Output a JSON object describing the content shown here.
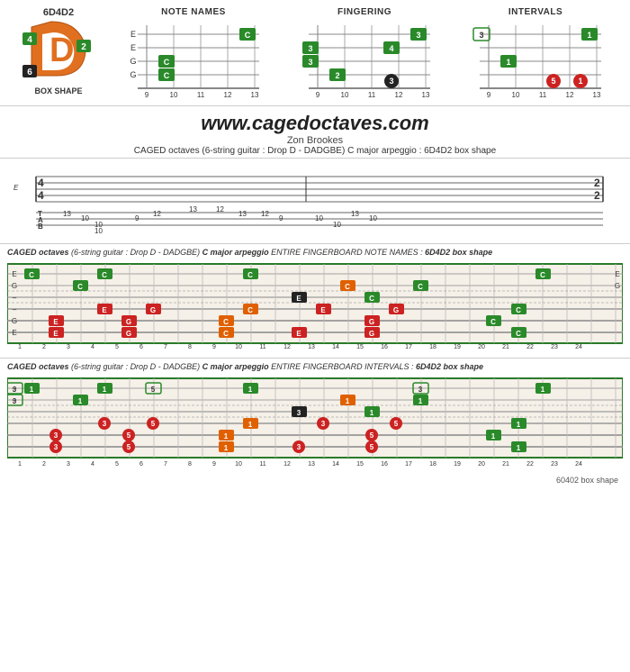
{
  "header": {
    "badge_label": "6D4D2",
    "box_shape_label": "BOX SHAPE",
    "d_letter": "D"
  },
  "diagrams": [
    {
      "title": "NOTE NAMES",
      "notes": [
        "E",
        "C",
        "G",
        "C"
      ]
    },
    {
      "title": "FINGERING",
      "notes": [
        "3",
        "4",
        "3",
        "2",
        "3"
      ]
    },
    {
      "title": "INTERVALS",
      "notes": [
        "3",
        "1",
        "5",
        "1"
      ]
    }
  ],
  "website": {
    "url": "www.cagedoctaves.com",
    "author": "Zon Brookes",
    "description": "CAGED octaves (6-string guitar : Drop D - DADGBE) C major arpeggio : 6D4D2 box shape"
  },
  "fingerboard1": {
    "title": "CAGED octaves (6-string guitar : Drop D - DADGBE) C major arpeggio ENTIRE FINGERBOARD NOTE NAMES : 6D4D2 box shape",
    "fret_start": 1,
    "fret_end": 24
  },
  "fingerboard2": {
    "title": "CAGED octaves (6-string guitar : Drop D - DADGBE) C major arpeggio ENTIRE FINGERBOARD INTERVALS : 6D4D2 box shape",
    "fret_start": 1,
    "fret_end": 24
  },
  "bottom_badge": "60402 box shape"
}
